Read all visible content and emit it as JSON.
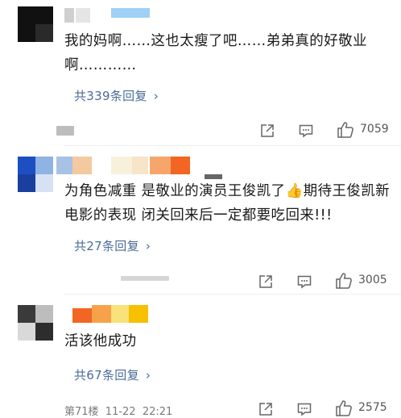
{
  "comments": [
    {
      "text": "我的妈啊……这也太瘦了吧……弟弟真的好敬业啊…………",
      "replies_label": "共339条回复",
      "meta": "",
      "likes": "7059",
      "username_blur_colors": [
        "#111111",
        "#cfcfcf",
        "#8fc7f0"
      ]
    },
    {
      "text": "为角色减重 是敬业的演员王俊凯了👍期待王俊凯新电影的表现 闭关回来后一定都要吃回来!!!",
      "replies_label": "共27条回复",
      "meta": "",
      "likes": "3005",
      "username_blur_colors": [
        "#1d4fc2",
        "#8fb3e3",
        "#f2c79a",
        "#f7f0dd",
        "#f6a66a",
        "#f26522"
      ]
    },
    {
      "text": "活该他成功",
      "replies_label": "共67条回复",
      "meta": "第71楼  11-22  22:21",
      "likes": "2575",
      "username_blur_colors": [
        "#f26522",
        "#f7a24a",
        "#f9e27a",
        "#f7c000"
      ]
    }
  ],
  "icons": {
    "share": "share-icon",
    "reply": "comment-icon",
    "like": "thumbs-up-icon"
  },
  "colors": {
    "link": "#4a6c99",
    "text": "#1a1a1a",
    "meta": "#7a7a7a",
    "icon": "#666666"
  }
}
